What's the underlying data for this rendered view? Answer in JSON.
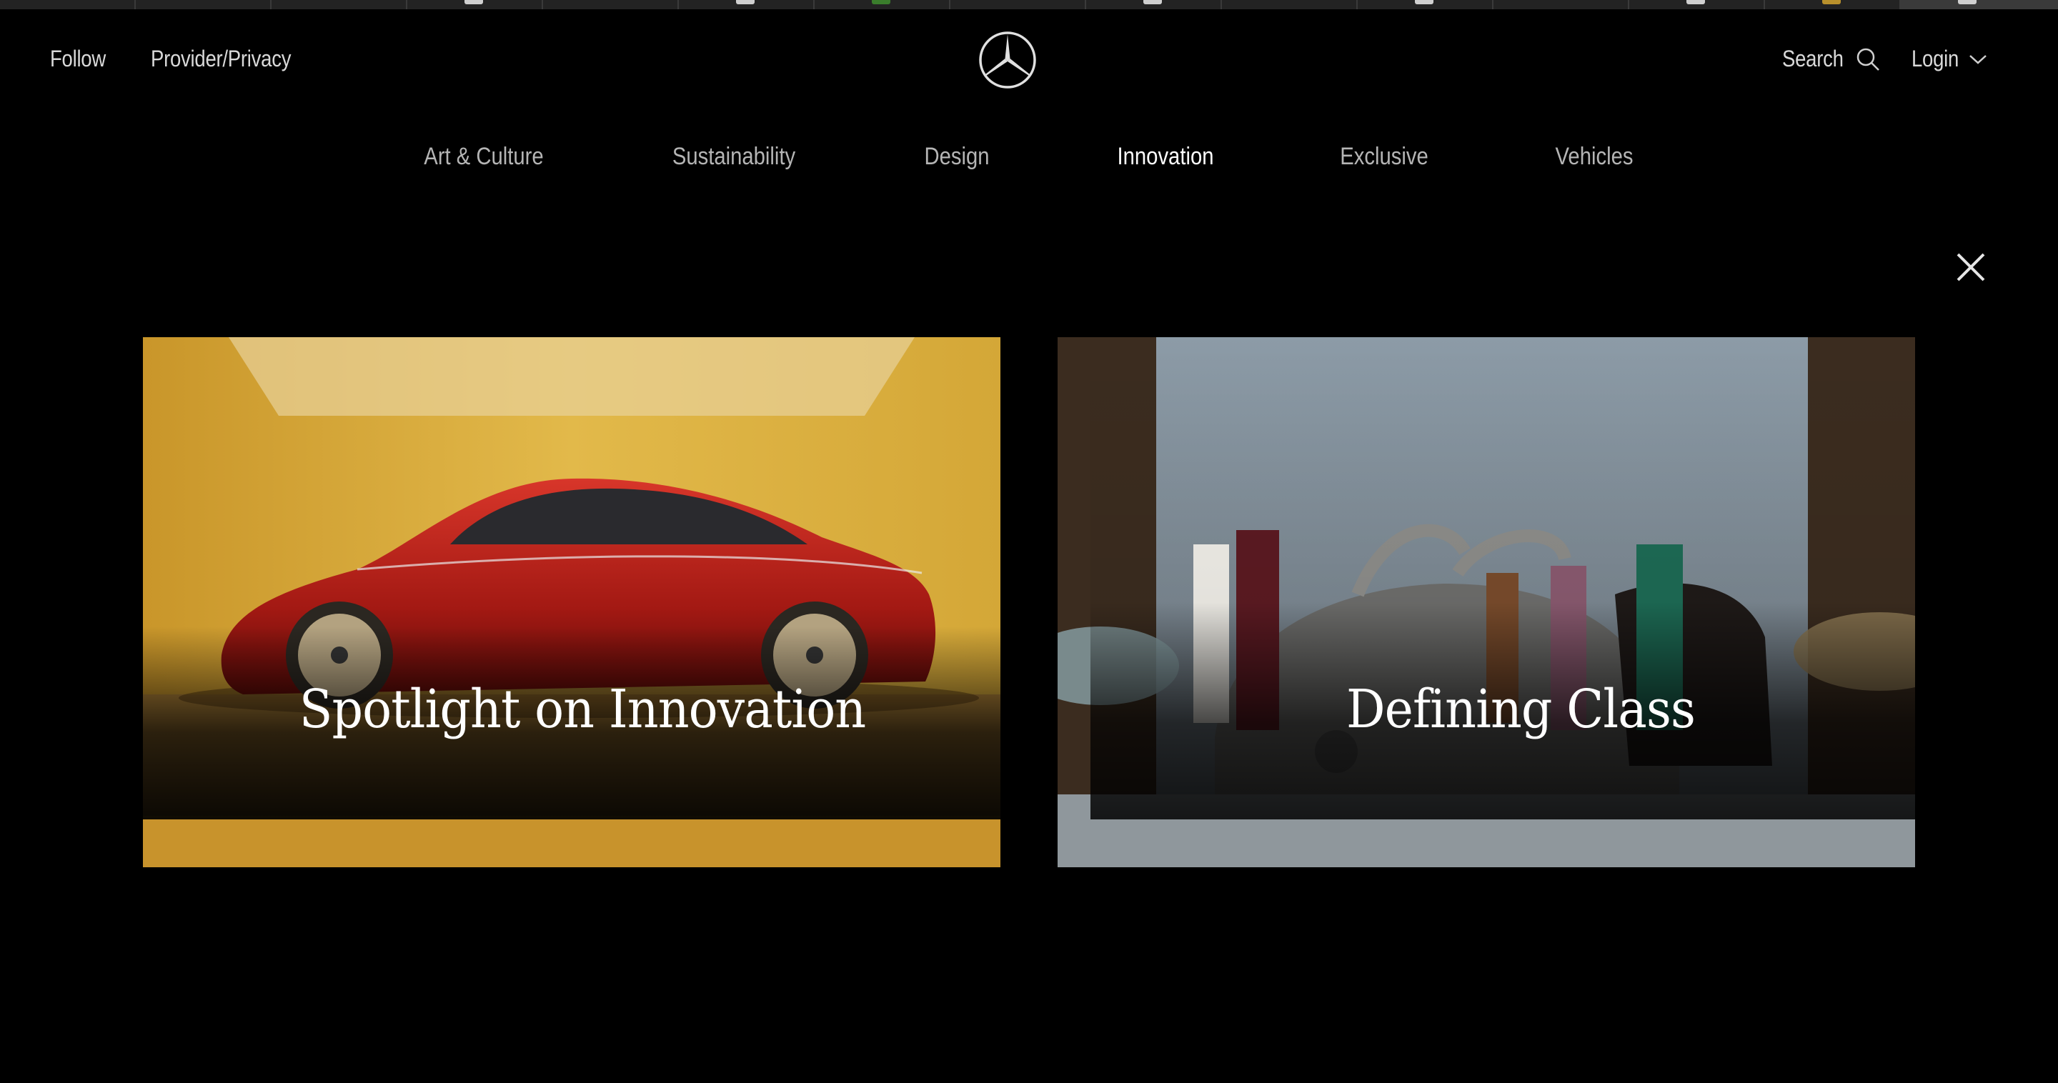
{
  "header": {
    "left_links": [
      "Follow",
      "Provider/Privacy"
    ],
    "logo_icon": "mercedes-star-icon",
    "search_label": "Search",
    "login_label": "Login"
  },
  "nav": {
    "items": [
      {
        "label": "Art & Culture",
        "active": false
      },
      {
        "label": "Sustainability",
        "active": false
      },
      {
        "label": "Design",
        "active": false
      },
      {
        "label": "Innovation",
        "active": true
      },
      {
        "label": "Exclusive",
        "active": false
      },
      {
        "label": "Vehicles",
        "active": false
      }
    ]
  },
  "cards": [
    {
      "title": "Spotlight on Innovation",
      "image": "red concept car on yellow background"
    },
    {
      "title": "Defining Class",
      "image": "group of people around a classic gullwing coupe"
    }
  ],
  "colors": {
    "background": "#000000",
    "text": "#d9d9d9",
    "active": "#ffffff"
  }
}
